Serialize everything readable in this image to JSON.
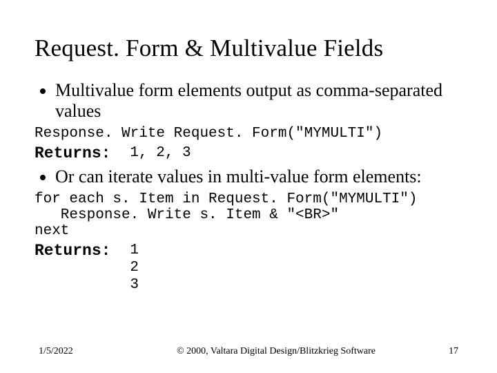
{
  "title": "Request. Form & Multivalue Fields",
  "bullet1": "Multivalue form elements output as comma-separated values",
  "code1": "Response. Write Request. Form(\"MYMULTI\")",
  "returns_label": "Returns:",
  "returns1_value": "1, 2, 3",
  "bullet2": "Or can iterate values in multi-value form elements:",
  "code2_line1": "for each s. Item in Request. Form(\"MYMULTI\")",
  "code2_line2": "   Response. Write s. Item & \"<BR>\"",
  "code2_line3": "next",
  "returns2_value": "1\n2\n3",
  "footer": {
    "date": "1/5/2022",
    "copyright": "© 2000, Valtara Digital Design/Blitzkrieg Software",
    "page": "17"
  }
}
